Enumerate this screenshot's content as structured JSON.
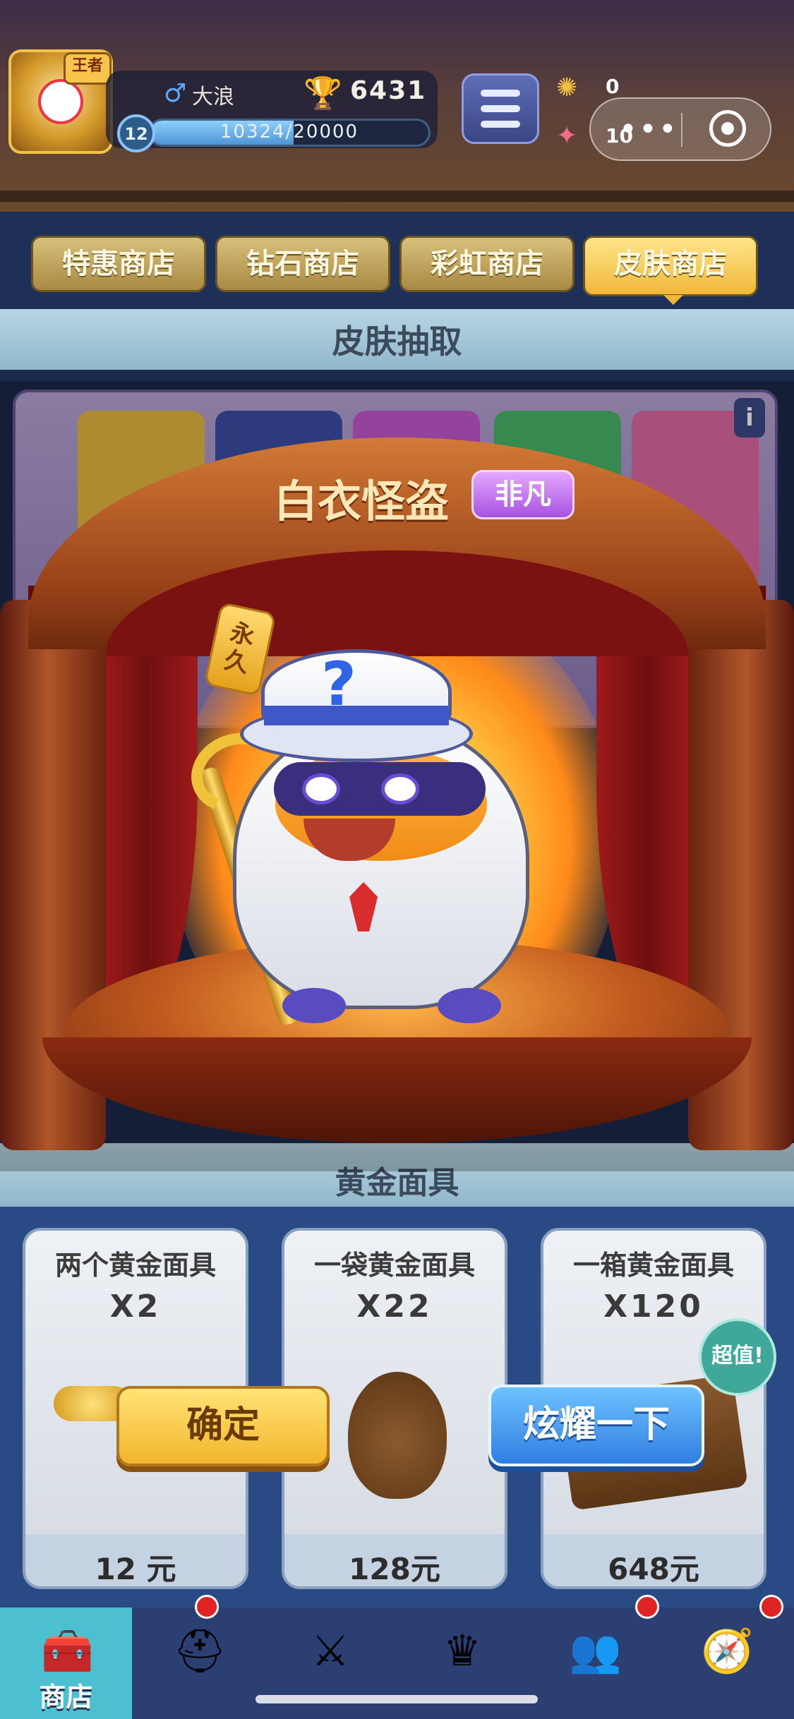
{
  "header": {
    "player_name": "大浪",
    "gender_icon": "male-icon",
    "rank_badge": "王者",
    "trophies": "6431",
    "level": "12",
    "xp_text": "10324/20000",
    "xp_progress": 0.5162,
    "masks_count": "0",
    "feathers_count": "10"
  },
  "tabs": [
    {
      "label": "特惠商店",
      "active": false
    },
    {
      "label": "钻石商店",
      "active": false
    },
    {
      "label": "彩虹商店",
      "active": false
    },
    {
      "label": "皮肤商店",
      "active": true
    }
  ],
  "section": {
    "title": "皮肤抽取"
  },
  "gold_section": {
    "title": "黄金面具"
  },
  "modal": {
    "skin_name": "白衣怪盗",
    "rarity": "非凡",
    "tag": "永久",
    "confirm_label": "确定",
    "show_label": "炫耀一下"
  },
  "shop_items": [
    {
      "name": "两个黄金面具",
      "qty": "X2",
      "price": "12 元"
    },
    {
      "name": "一袋黄金面具",
      "qty": "X22",
      "price": "128元"
    },
    {
      "name": "一箱黄金面具",
      "qty": "X120",
      "price": "648元"
    }
  ],
  "value_badge": "超值!",
  "nav": [
    {
      "label": "商店",
      "icon": "chest-icon",
      "active": true
    },
    {
      "label": "",
      "icon": "helmet-icon",
      "active": false
    },
    {
      "label": "",
      "icon": "crossed-swords-icon",
      "active": false
    },
    {
      "label": "",
      "icon": "crown-shield-icon",
      "active": false
    },
    {
      "label": "",
      "icon": "friends-banner-icon",
      "active": false
    },
    {
      "label": "",
      "icon": "compass-icon",
      "active": false
    }
  ],
  "colors": {
    "tab_active": "#f0b83a",
    "confirm_button": "#f3b52c",
    "share_button": "#2f7fe0",
    "rarity_badge": "#a852e0"
  }
}
